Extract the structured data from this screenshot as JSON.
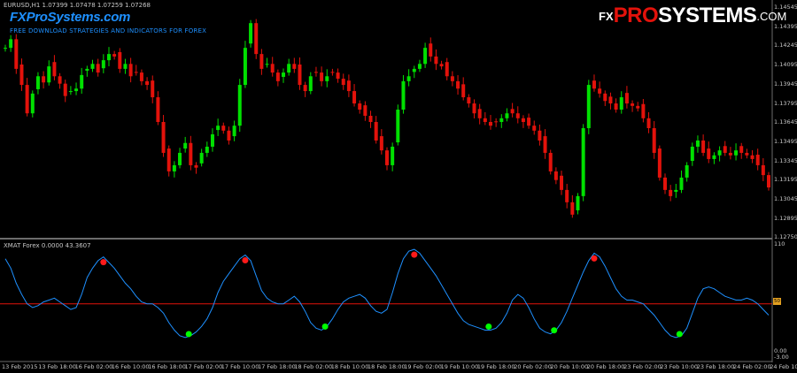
{
  "window": {
    "symbol_info": "EURUSD,H1  1.07399 1.07478 1.07259 1.07268"
  },
  "branding": {
    "site_name": "FXProSystems.com",
    "tagline": "FREE DOWNLOAD STRATEGIES AND INDICATORS FOR FOREX",
    "logo_fx": "FX",
    "logo_pro": "PRO",
    "logo_systems": "SYSTEMS",
    "logo_com": ".COM"
  },
  "indicator": {
    "label": "XMAT Forex 0.0000 43.3607",
    "scale_top": "110",
    "scale_bottom": "-3.00",
    "scale_min": "0.00",
    "level_label": "50"
  },
  "colors": {
    "bull": "#00e000",
    "bear": "#e3120b",
    "line": "#1e90ff",
    "level": "#e3120b",
    "dot_top": "#ff1a1a",
    "dot_bottom": "#00ff00"
  },
  "price_axis": [
    "1.14545",
    "1.14395",
    "1.14245",
    "1.14095",
    "1.13945",
    "1.13795",
    "1.13645",
    "1.13495",
    "1.13345",
    "1.13195",
    "1.13045",
    "1.12895",
    "1.12750"
  ],
  "date_axis": [
    "13 Feb 2015",
    "13 Feb 18:00",
    "16 Feb 02:00",
    "16 Feb 10:00",
    "16 Feb 18:00",
    "17 Feb 02:00",
    "17 Feb 10:00",
    "17 Feb 18:00",
    "18 Feb 02:00",
    "18 Feb 10:00",
    "18 Feb 18:00",
    "19 Feb 02:00",
    "19 Feb 10:00",
    "19 Feb 18:00",
    "20 Feb 02:00",
    "20 Feb 10:00",
    "20 Feb 18:00",
    "23 Feb 02:00",
    "23 Feb 10:00",
    "23 Feb 18:00",
    "24 Feb 02:00",
    "24 Feb 10:00"
  ],
  "chart_data": {
    "type": "candlestick",
    "instrument": "EURUSD,H1",
    "price_range": [
      1.1272,
      1.1458
    ],
    "closes": [
      1.1425,
      1.1432,
      1.1408,
      1.1395,
      1.1372,
      1.1388,
      1.1402,
      1.1397,
      1.141,
      1.1402,
      1.1396,
      1.1386,
      1.139,
      1.1392,
      1.1403,
      1.1408,
      1.1412,
      1.1405,
      1.1415,
      1.142,
      1.1418,
      1.1408,
      1.1412,
      1.1402,
      1.1405,
      1.1398,
      1.1395,
      1.1385,
      1.1365,
      1.134,
      1.1325,
      1.133,
      1.134,
      1.1348,
      1.133,
      1.1328,
      1.134,
      1.1345,
      1.1355,
      1.1362,
      1.1358,
      1.135,
      1.1362,
      1.1395,
      1.1425,
      1.1445,
      1.142,
      1.1408,
      1.1412,
      1.1405,
      1.1398,
      1.1405,
      1.1412,
      1.1408,
      1.1395,
      1.139,
      1.1402,
      1.1405,
      1.1398,
      1.1402,
      1.1405,
      1.14,
      1.1395,
      1.139,
      1.138,
      1.1375,
      1.137,
      1.1365,
      1.135,
      1.1342,
      1.133,
      1.1345,
      1.1375,
      1.1398,
      1.1402,
      1.1408,
      1.1412,
      1.1425,
      1.1418,
      1.1412,
      1.141,
      1.1402,
      1.1398,
      1.1392,
      1.1385,
      1.138,
      1.1372,
      1.1368,
      1.1365,
      1.1362,
      1.1365,
      1.1368,
      1.1372,
      1.1372,
      1.1368,
      1.1365,
      1.1362,
      1.1358,
      1.135,
      1.134,
      1.1325,
      1.1318,
      1.131,
      1.13,
      1.129,
      1.1305,
      1.136,
      1.1395,
      1.1392,
      1.1388,
      1.1382,
      1.138,
      1.1375,
      1.1385,
      1.138,
      1.1378,
      1.1376,
      1.1368,
      1.136,
      1.134,
      1.132,
      1.131,
      1.1305,
      1.131,
      1.132,
      1.133,
      1.1345,
      1.135,
      1.134,
      1.1335,
      1.1338,
      1.1342,
      1.134,
      1.1338,
      1.1342,
      1.134,
      1.1338,
      1.1335,
      1.133,
      1.1322,
      1.1312
    ],
    "oscillator": [
      98,
      88,
      72,
      60,
      50,
      46,
      48,
      52,
      54,
      56,
      52,
      48,
      44,
      46,
      60,
      78,
      88,
      96,
      100,
      94,
      88,
      80,
      72,
      66,
      58,
      52,
      50,
      50,
      46,
      40,
      30,
      22,
      16,
      14,
      16,
      20,
      26,
      34,
      46,
      62,
      74,
      82,
      90,
      98,
      102,
      96,
      80,
      64,
      56,
      52,
      50,
      50,
      54,
      58,
      52,
      42,
      30,
      24,
      22,
      26,
      34,
      44,
      52,
      56,
      58,
      60,
      56,
      48,
      42,
      40,
      44,
      62,
      82,
      98,
      106,
      108,
      104,
      96,
      88,
      80,
      70,
      60,
      50,
      40,
      32,
      28,
      26,
      24,
      22,
      22,
      24,
      30,
      40,
      54,
      60,
      56,
      46,
      34,
      24,
      20,
      18,
      22,
      30,
      42,
      56,
      70,
      84,
      96,
      104,
      100,
      90,
      78,
      66,
      58,
      54,
      54,
      52,
      50,
      44,
      38,
      30,
      22,
      16,
      14,
      16,
      24,
      40,
      56,
      66,
      68,
      66,
      62,
      58,
      56,
      54,
      54,
      56,
      54,
      50,
      44,
      38
    ]
  }
}
